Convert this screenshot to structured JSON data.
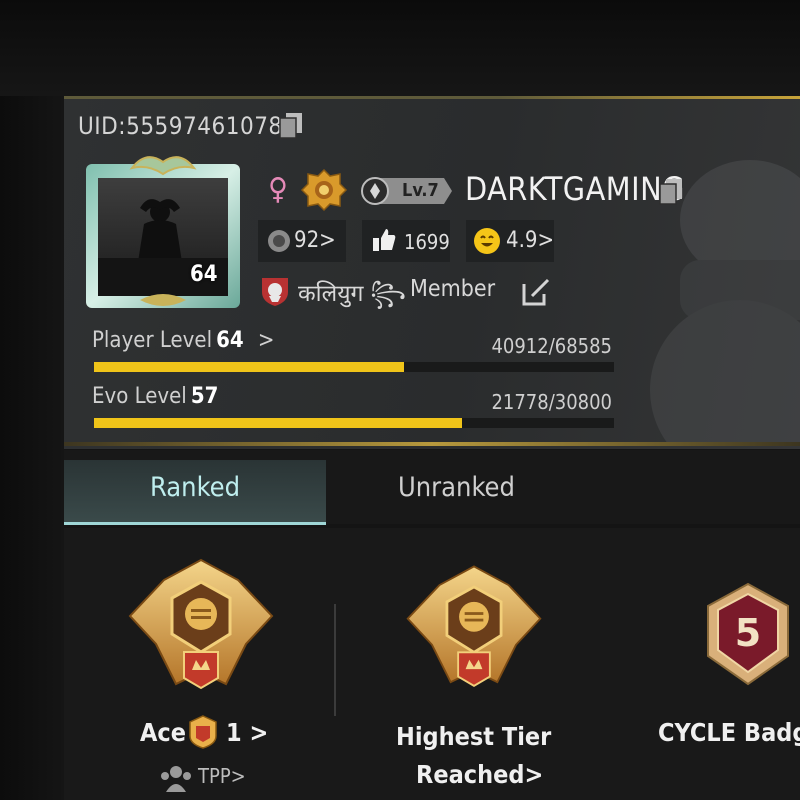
{
  "profile": {
    "uid": "UID:55597461078",
    "avatar_level": "64",
    "gender_symbol": "♀",
    "account_level": "Lv.7",
    "name": "DARKTGAMING",
    "stats": {
      "popularity": "92>",
      "likes": "1699",
      "rating": "4.9>"
    },
    "clan": {
      "name": "कलियुग ꧂",
      "role": "Member"
    }
  },
  "levels": {
    "player": {
      "label": "Player Level",
      "value": "64",
      "arrow": ">",
      "progress_text": "40912/68585",
      "current": 40912,
      "max": 68585
    },
    "evo": {
      "label": "Evo Level",
      "value": "57",
      "progress_text": "21778/30800",
      "current": 21778,
      "max": 30800
    }
  },
  "tabs": [
    {
      "label": "Ranked",
      "active": true
    },
    {
      "label": "Unranked",
      "active": false
    }
  ],
  "ranked": {
    "current_tier": "Ace",
    "current_tier_num": "1 >",
    "mode": "TPP>",
    "highest_tier_line1": "Highest Tier",
    "highest_tier_line2": "Reached>",
    "cycle_label": "CYCLE Badg",
    "cycle_number": "5"
  },
  "colors": {
    "accent_gold": "#f0c419",
    "tab_active_underline": "#9fd6d6",
    "gender_pink": "#e58ab8"
  },
  "icons": [
    "copy-icon",
    "female-icon",
    "rank-badge-icon",
    "level-pill-icon",
    "popularity-icon",
    "thumbs-up-icon",
    "smiley-icon",
    "clan-emblem-icon",
    "edit-icon",
    "ace-emblem-icon",
    "ace-mini-icon",
    "squad-icon",
    "cycle-badge-icon"
  ]
}
